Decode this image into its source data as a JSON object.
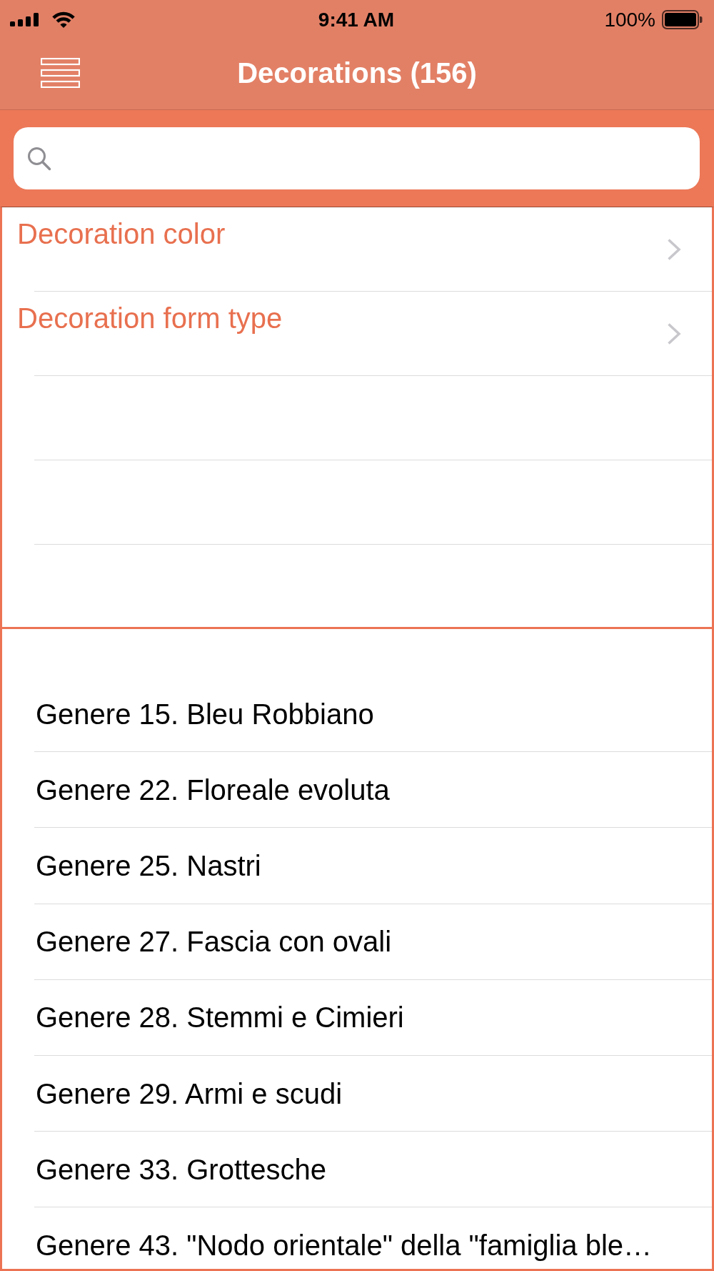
{
  "status_bar": {
    "time": "9:41 AM",
    "battery": "100%"
  },
  "nav_bar": {
    "title": "Decorations (156)"
  },
  "filters": [
    {
      "label": "Decoration color",
      "kind": "disclosure"
    },
    {
      "label": "Decoration form type",
      "kind": "disclosure"
    }
  ],
  "genres": [
    {
      "label": "Genere 15. Bleu Robbiano"
    },
    {
      "label": "Genere 22. Floreale evoluta"
    },
    {
      "label": "Genere 25. Nastri"
    },
    {
      "label": "Genere 27. Fascia con ovali"
    },
    {
      "label": "Genere 28. Stemmi e Cimieri"
    },
    {
      "label": "Genere 29. Armi e scudi"
    },
    {
      "label": "Genere 33. Grottesche"
    },
    {
      "label": "Genere 43. \"Nodo orientale\" della \"famiglia ble…"
    }
  ]
}
